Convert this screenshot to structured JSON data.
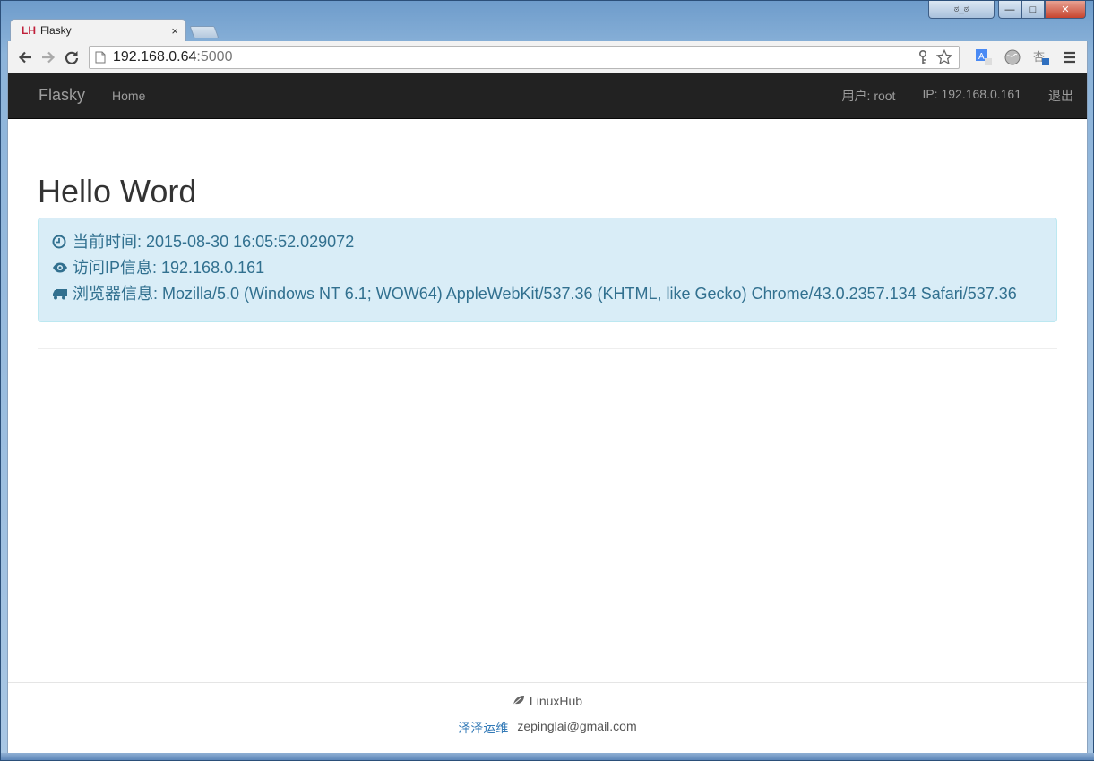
{
  "browser": {
    "tab": {
      "favicon": "LH",
      "title": "Flasky",
      "close": "×"
    },
    "url": {
      "host": "192.168.0.64",
      "port": ":5000"
    },
    "caption": {
      "profile": "ಠ_ಠ",
      "minimize": "—",
      "maximize": "□",
      "close": "✕"
    }
  },
  "navbar": {
    "brand": "Flasky",
    "home": "Home",
    "user": "用户: root",
    "ip": "IP: 192.168.0.161",
    "logout": "退出"
  },
  "main": {
    "title": "Hello Word",
    "time_line": "当前时间: 2015-08-30 16:05:52.029072",
    "ip_line": "访问IP信息: 192.168.0.161",
    "browser_line": "浏览器信息: Mozilla/5.0 (Windows NT 6.1; WOW64) AppleWebKit/537.36 (KHTML, like Gecko) Chrome/43.0.2357.134 Safari/537.36"
  },
  "footer": {
    "brand": "LinuxHub",
    "author_link": "泽泽运维",
    "email": "zepinglai@gmail.com"
  },
  "colors": {
    "navbar_bg": "#222222",
    "alert_bg": "#d9edf7",
    "alert_text": "#31708f",
    "link": "#337ab7"
  },
  "icons": {
    "time": "clock-icon",
    "ip": "eye-icon",
    "browser": "truck-icon",
    "footer": "leaf-icon"
  }
}
